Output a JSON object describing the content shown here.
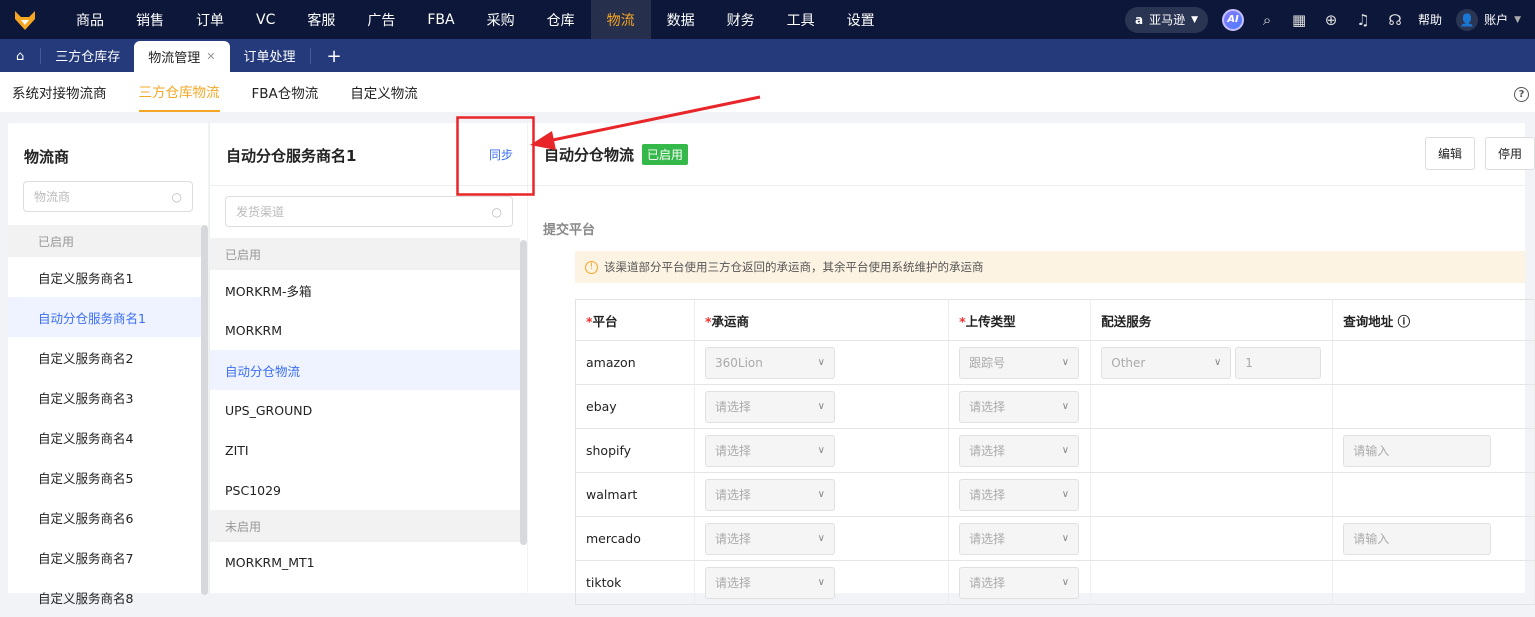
{
  "topnav": {
    "items": [
      "商品",
      "销售",
      "订单",
      "VC",
      "客服",
      "广告",
      "FBA",
      "采购",
      "仓库",
      "物流",
      "数据",
      "财务",
      "工具",
      "设置"
    ],
    "active": "物流",
    "platform": "亚马逊",
    "ai": "AI",
    "help": "帮助",
    "account": "账户"
  },
  "tabs": {
    "items": [
      "三方仓库存",
      "物流管理",
      "订单处理"
    ],
    "active": "物流管理",
    "add": "+",
    "close": "✕"
  },
  "subnav": {
    "items": [
      "系统对接物流商",
      "三方仓库物流",
      "FBA仓物流",
      "自定义物流"
    ],
    "active": "三方仓库物流",
    "help": "?"
  },
  "providers": {
    "title": "物流商",
    "placeholder": "物流商",
    "group": "已启用",
    "items": [
      "自定义服务商名1",
      "自动分仓服务商名1",
      "自定义服务商名2",
      "自定义服务商名3",
      "自定义服务商名4",
      "自定义服务商名5",
      "自定义服务商名6",
      "自定义服务商名7",
      "自定义服务商名8"
    ],
    "selected": 1
  },
  "channels": {
    "title": "自动分仓服务商名1",
    "sync": "同步",
    "placeholder": "发货渠道",
    "enabled_group": "已启用",
    "enabled": [
      "MORKRM-多箱",
      "MORKRM",
      "自动分仓物流",
      "UPS_GROUND",
      "ZITI",
      "PSC1029"
    ],
    "disabled_group": "未启用",
    "disabled": [
      "MORKRM_MT1"
    ]
  },
  "detail": {
    "title": "自动分仓物流",
    "status": "已启用",
    "edit": "编辑",
    "disable": "停用",
    "section": "提交平台",
    "alert": "该渠道部分平台使用三方仓返回的承运商，其余平台使用系统维护的承运商",
    "columns": [
      "平台",
      "承运商",
      "上传类型",
      "配送服务",
      "查询地址"
    ],
    "rows": [
      {
        "platform": "amazon",
        "carrier": "360Lion",
        "upload": "跟踪号",
        "service": "Other",
        "service_num": "1",
        "query": null
      },
      {
        "platform": "ebay",
        "carrier": "请选择",
        "upload": "请选择",
        "service": null,
        "query": null
      },
      {
        "platform": "shopify",
        "carrier": "请选择",
        "upload": "请选择",
        "service": null,
        "query": "请输入"
      },
      {
        "platform": "walmart",
        "carrier": "请选择",
        "upload": "请选择",
        "service": null,
        "query": null
      },
      {
        "platform": "mercado",
        "carrier": "请选择",
        "upload": "请选择",
        "service": null,
        "query": "请输入"
      },
      {
        "platform": "tiktok",
        "carrier": "请选择",
        "upload": "请选择",
        "service": null,
        "query": null
      }
    ]
  },
  "colors": {
    "accent": "#f5a623",
    "primary": "#3b6ef5",
    "success": "#35b84a",
    "annotation": "#e8262a"
  }
}
